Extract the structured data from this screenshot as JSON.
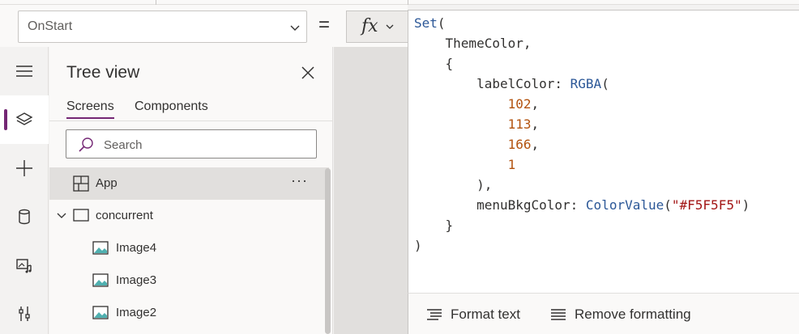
{
  "formula_bar": {
    "property": "OnStart",
    "equals": "=",
    "fx": "fx"
  },
  "tree_view": {
    "title": "Tree view",
    "tabs": [
      "Screens",
      "Components"
    ],
    "active_tab": "Screens",
    "search_placeholder": "Search",
    "items": [
      {
        "label": "App",
        "icon": "app-icon",
        "selected": true
      },
      {
        "label": "concurrent",
        "icon": "screen-icon",
        "expanded": true
      },
      {
        "label": "Image4",
        "icon": "image-icon"
      },
      {
        "label": "Image3",
        "icon": "image-icon"
      },
      {
        "label": "Image2",
        "icon": "image-icon"
      }
    ],
    "more": "···"
  },
  "rail": [
    "hamburger-icon",
    "layers-icon",
    "plus-icon",
    "data-icon",
    "media-icon",
    "tools-icon"
  ],
  "code": {
    "lines": [
      [
        {
          "t": "Set",
          "c": "fn"
        },
        {
          "t": "("
        }
      ],
      [
        {
          "t": "    ThemeColor,"
        }
      ],
      [
        {
          "t": "    {"
        }
      ],
      [
        {
          "t": "        labelColor: "
        },
        {
          "t": "RGBA",
          "c": "fn"
        },
        {
          "t": "("
        }
      ],
      [
        {
          "t": "            "
        },
        {
          "t": "102",
          "c": "num"
        },
        {
          "t": ","
        }
      ],
      [
        {
          "t": "            "
        },
        {
          "t": "113",
          "c": "num"
        },
        {
          "t": ","
        }
      ],
      [
        {
          "t": "            "
        },
        {
          "t": "166",
          "c": "num"
        },
        {
          "t": ","
        }
      ],
      [
        {
          "t": "            "
        },
        {
          "t": "1",
          "c": "num"
        }
      ],
      [
        {
          "t": "        ),"
        }
      ],
      [
        {
          "t": "        menuBkgColor: "
        },
        {
          "t": "ColorValue",
          "c": "fn"
        },
        {
          "t": "("
        },
        {
          "t": "\"#F5F5F5\"",
          "c": "str"
        },
        {
          "t": ")"
        }
      ],
      [
        {
          "t": "    }"
        }
      ],
      [
        {
          "t": ")"
        }
      ]
    ]
  },
  "editor_toolbar": {
    "format_text": "Format text",
    "remove_formatting": "Remove formatting"
  },
  "colors": {
    "accent": "#742774",
    "code_function": "#2b5797",
    "code_number": "#b3530f",
    "code_string": "#a31515"
  }
}
